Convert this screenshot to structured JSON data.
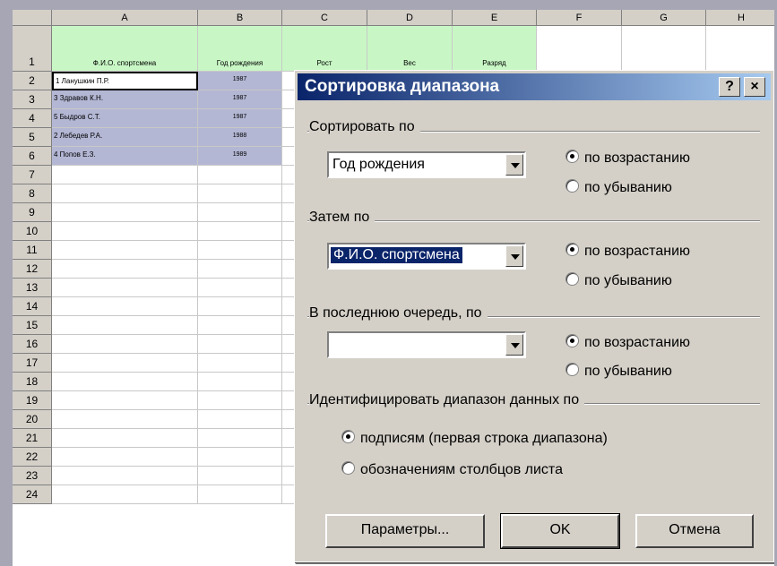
{
  "spreadsheet": {
    "columns": [
      "A",
      "B",
      "C",
      "D",
      "E",
      "F",
      "G",
      "H"
    ],
    "header_row": [
      "Ф.И.О. спортсмена",
      "Год рождения",
      "Рост",
      "Вес",
      "Разряд"
    ],
    "rows": [
      {
        "name": "1 Ланушкин П.Р.",
        "year": "1987"
      },
      {
        "name": "3 Здравов К.Н.",
        "year": "1987"
      },
      {
        "name": "5 Быдров С.Т.",
        "year": "1987"
      },
      {
        "name": "2 Лебедев Р.А.",
        "year": "1988"
      },
      {
        "name": "4 Попов Е.З.",
        "year": "1989"
      }
    ],
    "row_numbers": [
      "1",
      "2",
      "3",
      "4",
      "5",
      "6",
      "7",
      "8",
      "9",
      "10",
      "11",
      "12",
      "13",
      "14",
      "15",
      "16",
      "17",
      "18",
      "19",
      "20",
      "21",
      "22",
      "23",
      "24"
    ]
  },
  "dialog": {
    "title": "Сортировка диапазона",
    "help_button": "?",
    "close_button": "×",
    "sort_by": {
      "label": "Сортировать по",
      "value": "Год рождения",
      "asc": "по возрастанию",
      "desc": "по убыванию",
      "selected": "asc"
    },
    "then_by": {
      "label": "Затем по",
      "value": "Ф.И.О. спортсмена",
      "asc": "по возрастанию",
      "desc": "по убыванию",
      "selected": "asc"
    },
    "last_by": {
      "label": "В последнюю очередь, по",
      "value": "",
      "asc": "по возрастанию",
      "desc": "по убыванию",
      "selected": "asc"
    },
    "identify": {
      "label": "Идентифицировать диапазон данных по",
      "option_labels": "подписям (первая строка диапазона)",
      "option_columns": "обозначениям столбцов листа",
      "selected": "labels"
    },
    "buttons": {
      "options": "Параметры...",
      "ok": "OK",
      "cancel": "Отмена"
    }
  }
}
